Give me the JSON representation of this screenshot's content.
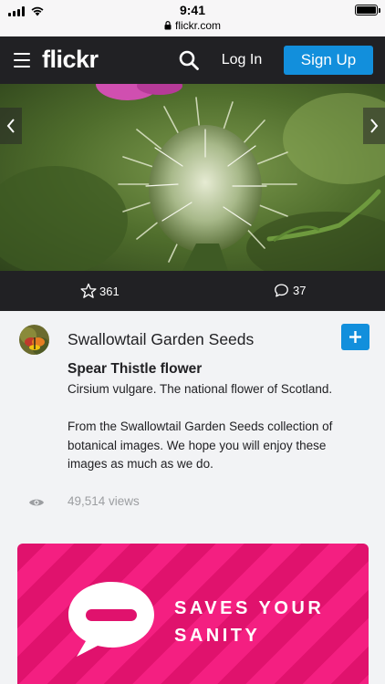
{
  "status_bar": {
    "time": "9:41",
    "url": "flickr.com"
  },
  "header": {
    "logo": "flickr",
    "login_label": "Log In",
    "signup_label": "Sign Up",
    "menu_icon": "hamburger-menu-icon",
    "search_icon": "search-icon"
  },
  "photo": {
    "prev_icon": "chevron-left-icon",
    "next_icon": "chevron-right-icon"
  },
  "stats": {
    "favorites": "361",
    "comments": "37",
    "favorite_icon": "star-icon",
    "comment_icon": "comment-icon"
  },
  "info": {
    "owner_name": "Swallowtail Garden Seeds",
    "follow_icon": "plus-icon",
    "title": "Spear Thistle flower",
    "description": "Cirsium vulgare. The national flower of Scotland.\n\nFrom the Swallowtail Garden Seeds collection of botanical images. We hope you will enjoy these images as much as we do.",
    "views": "49,514 views",
    "views_icon": "eye-icon"
  },
  "ad": {
    "line1": "SAVES YOUR",
    "line2": "SANITY",
    "icon": "speech-bubble-icon"
  },
  "colors": {
    "header_bg": "#212124",
    "accent_blue": "#128fdc",
    "ad_pink": "#e0126d",
    "page_bg": "#f2f3f5"
  }
}
